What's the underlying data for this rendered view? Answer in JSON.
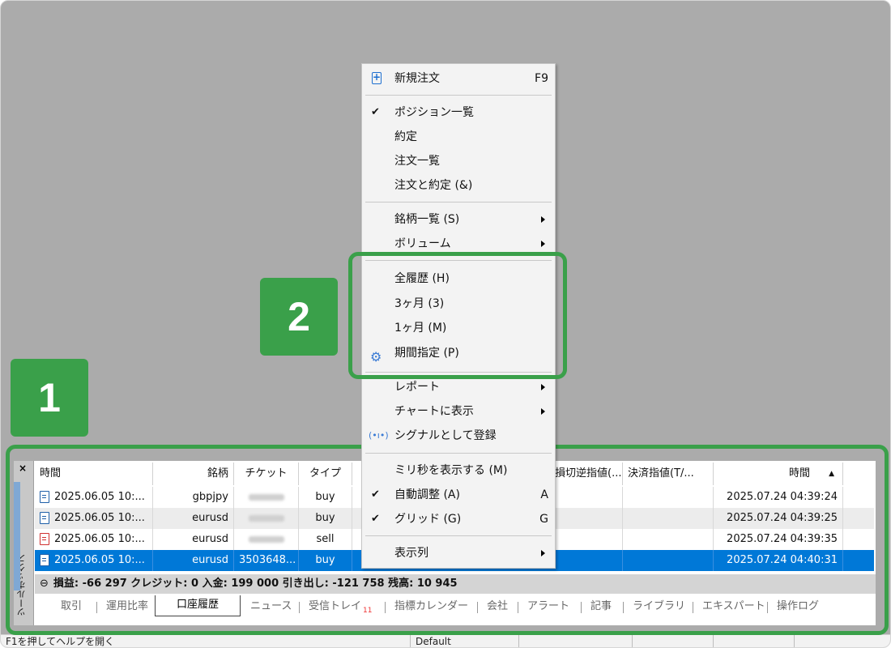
{
  "menu": {
    "items": [
      {
        "label": "新規注文",
        "shortcut": "F9",
        "icon": "new-order-icon"
      },
      {
        "label": "ポジション一覧",
        "checked": true
      },
      {
        "label": "約定"
      },
      {
        "label": "注文一覧"
      },
      {
        "label": "注文と約定 (&)"
      },
      {
        "label": "銘柄一覧 (S)",
        "submenu": true
      },
      {
        "label": "ボリューム",
        "submenu": true
      },
      {
        "label": "全履歴 (H)"
      },
      {
        "label": "3ヶ月 (3)"
      },
      {
        "label": "1ヶ月 (M)"
      },
      {
        "label": "期間指定 (P)",
        "icon": "gear-icon"
      },
      {
        "label": "レポート",
        "submenu": true
      },
      {
        "label": "チャートに表示",
        "submenu": true
      },
      {
        "label": "シグナルとして登録",
        "icon": "signal-icon"
      },
      {
        "label": "ミリ秒を表示する (M)"
      },
      {
        "label": "自動調整 (A)",
        "shortcut": "A",
        "checked": true
      },
      {
        "label": "グリッド (G)",
        "shortcut": "G",
        "checked": true
      },
      {
        "label": "表示列",
        "submenu": true
      }
    ],
    "check_glyph": "✔",
    "signal_glyph": "(•ı•)"
  },
  "toolbox": {
    "vertical_label": "ツールボックス",
    "close_glyph": "×",
    "columns": [
      "時間",
      "銘柄",
      "チケット",
      "タイプ",
      "損切逆指値(...",
      "決済指値(T/...",
      "時間"
    ],
    "sort_glyph": "▲",
    "rows": [
      {
        "time": "2025.06.05 10:...",
        "symbol": "gbpjpy",
        "ticket": "",
        "type": "buy",
        "close_time": "2025.07.24 04:39:24",
        "icon": "doc-blue"
      },
      {
        "time": "2025.06.05 10:...",
        "symbol": "eurusd",
        "ticket": "",
        "type": "buy",
        "close_time": "2025.07.24 04:39:25",
        "icon": "doc-blue"
      },
      {
        "time": "2025.06.05 10:...",
        "symbol": "eurusd",
        "ticket": "",
        "type": "sell",
        "close_time": "2025.07.24 04:39:35",
        "icon": "doc-red"
      },
      {
        "time": "2025.06.05 10:...",
        "symbol": "eurusd",
        "ticket": "3503648...",
        "type": "buy",
        "close_time": "2025.07.24 04:40:31",
        "icon": "doc-blue",
        "selected": true
      }
    ],
    "summary_glyph": "⊖",
    "summary": "損益: -66 297  クレジット: 0  入金: 199 000  引き出し: -121 758  残高: 10 945",
    "tabs": [
      {
        "label": "取引"
      },
      {
        "label": "運用比率"
      },
      {
        "label": "口座履歴",
        "active": true
      },
      {
        "label": "ニュース"
      },
      {
        "label": "受信トレイ",
        "badge": "11"
      },
      {
        "label": "指標カレンダー"
      },
      {
        "label": "会社"
      },
      {
        "label": "アラート"
      },
      {
        "label": "記事"
      },
      {
        "label": "ライブラリ"
      },
      {
        "label": "エキスパート"
      },
      {
        "label": "操作ログ"
      }
    ]
  },
  "status": {
    "help": "F1を押してヘルプを開く",
    "profile": "Default"
  },
  "annotations": {
    "badge1": "1",
    "badge2": "2",
    "accent": "#3aa04a"
  },
  "colors": {
    "selection": "#0078d7",
    "background": "#ababab"
  }
}
